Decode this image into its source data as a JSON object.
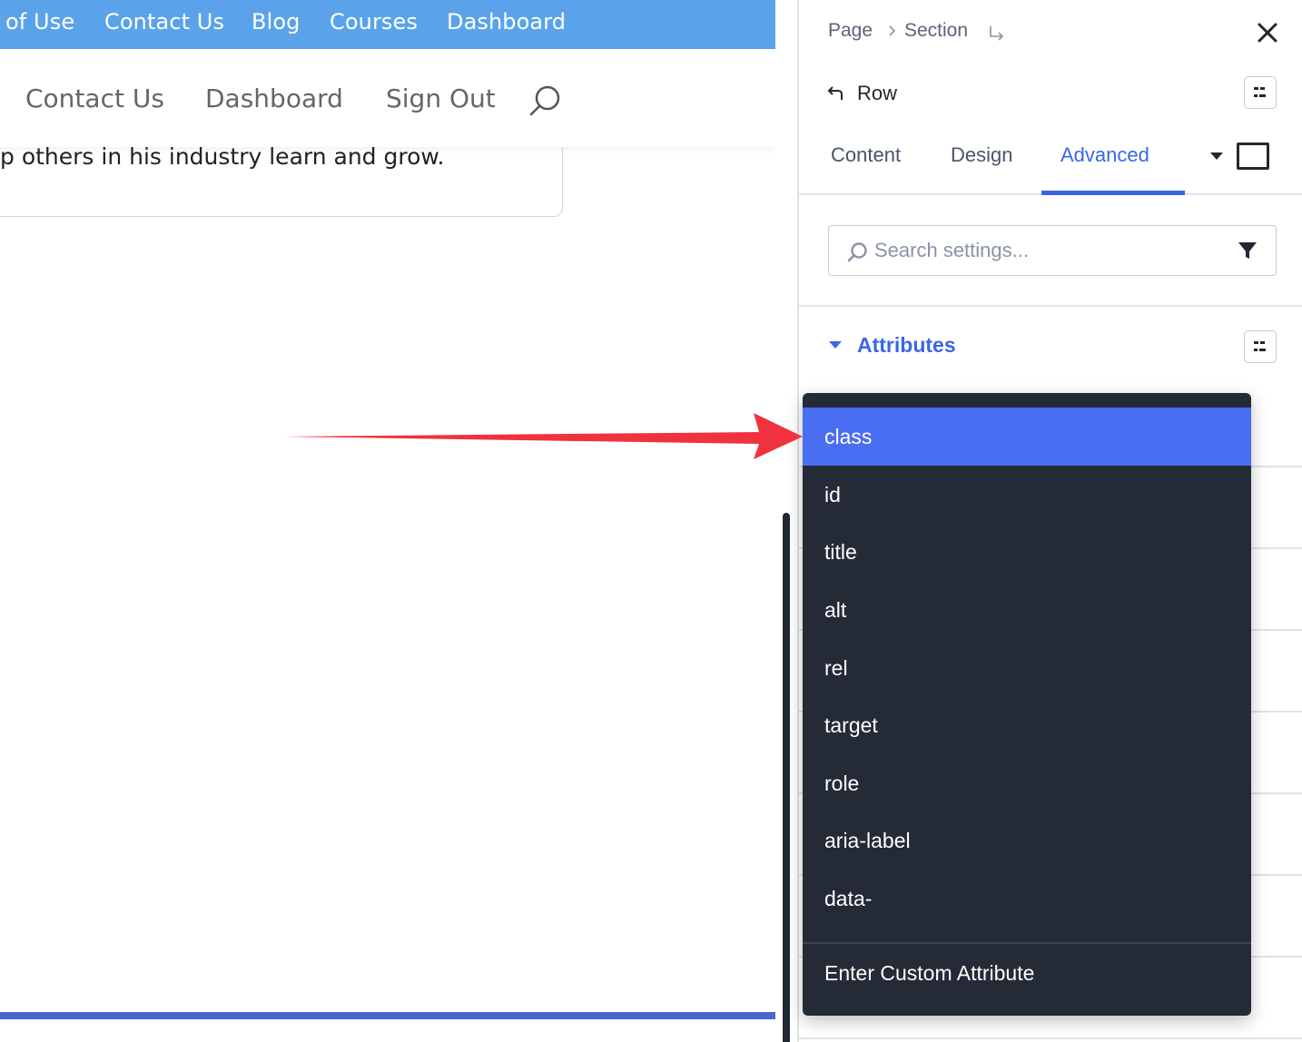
{
  "preview": {
    "top_links": [
      "of Use",
      "Contact Us",
      "Blog",
      "Courses",
      "Dashboard"
    ],
    "main_links": [
      "Contact Us",
      "Dashboard",
      "Sign Out"
    ],
    "content_text": "p others in his industry learn and grow."
  },
  "panel": {
    "breadcrumb": [
      "Page",
      "Section"
    ],
    "element_label": "Row",
    "tabs": [
      {
        "label": "Content",
        "active": false
      },
      {
        "label": "Design",
        "active": false
      },
      {
        "label": "Advanced",
        "active": true
      }
    ],
    "search": {
      "placeholder": "Search settings..."
    },
    "group_label": "Attributes"
  },
  "dropdown": {
    "items": [
      "class",
      "id",
      "title",
      "alt",
      "rel",
      "target",
      "role",
      "aria-label",
      "data-"
    ],
    "selected": "class",
    "custom_label": "Enter Custom Attribute"
  },
  "colors": {
    "top_bar": "#5aa3ea",
    "accent": "#3b66e8",
    "dropdown_bg": "#252b36",
    "dropdown_selected": "#4a6ef2",
    "arrow": "#f0323e"
  },
  "icons": [
    "search-icon",
    "chevron-right-icon",
    "return-arrow-icon",
    "close-icon",
    "back-arrow-icon",
    "options-icon",
    "caret-down-icon",
    "desktop-icon",
    "magnifier-icon",
    "filter-icon"
  ]
}
